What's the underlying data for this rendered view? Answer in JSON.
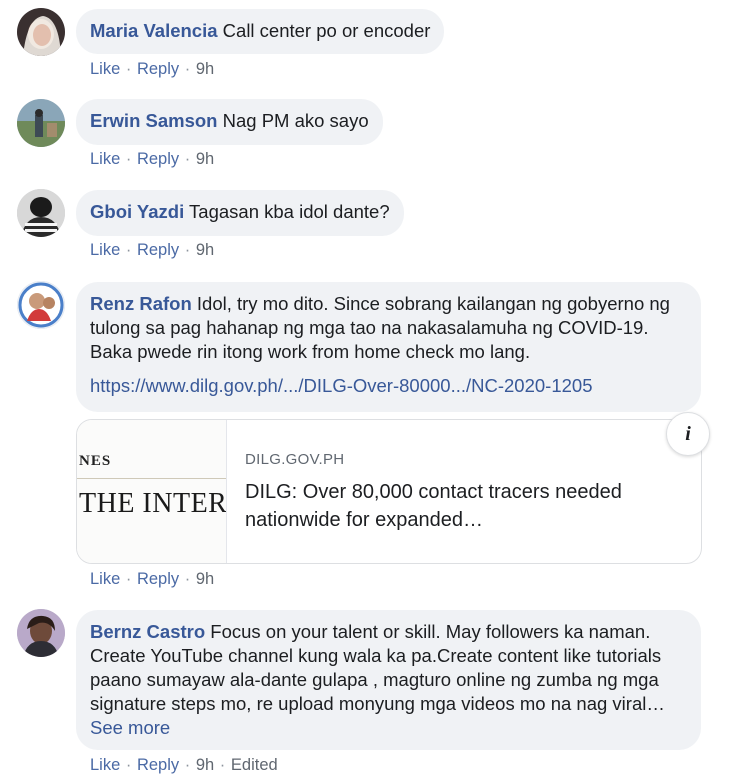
{
  "actions": {
    "like": "Like",
    "reply": "Reply",
    "sep": "·"
  },
  "comments": [
    {
      "name": "Maria Valencia",
      "text": "Call center po or encoder",
      "time": "9h"
    },
    {
      "name": "Erwin Samson",
      "text": "Nag PM ako sayo",
      "time": "9h"
    },
    {
      "name": "Gboi Yazdi",
      "text": "Tagasan kba idol dante?",
      "time": "9h"
    },
    {
      "name": "Renz Rafon",
      "text": "Idol, try mo dito. Since sobrang kailangan ng gobyerno ng tulong sa pag hahanap ng mga tao na nakasalamuha ng COVID-19. Baka pwede rin itong work from home check mo lang.",
      "link": "https://www.dilg.gov.ph/.../DILG-Over-80000.../NC-2020-1205",
      "time": "9h",
      "preview": {
        "image_text_top": "NES",
        "image_text_main": "THE INTERIOR",
        "domain": "DILG.GOV.PH",
        "title": "DILG: Over 80,000 contact tracers needed nationwide for expanded…",
        "info_icon": "info-icon"
      }
    },
    {
      "name": "Bernz Castro",
      "text": "Focus on your talent or skill. May followers ka naman. Create YouTube channel kung wala ka pa.Create content like tutorials paano sumayaw ala-dante gulapa , magturo online ng zumba ng mga signature steps mo, re upload monyung mga videos mo na nag viral…",
      "see_more": "See more",
      "time": "9h",
      "edited": "Edited"
    }
  ],
  "colors": {
    "name": "#385898",
    "bubble": "#f0f2f5",
    "meta": "#606770"
  }
}
